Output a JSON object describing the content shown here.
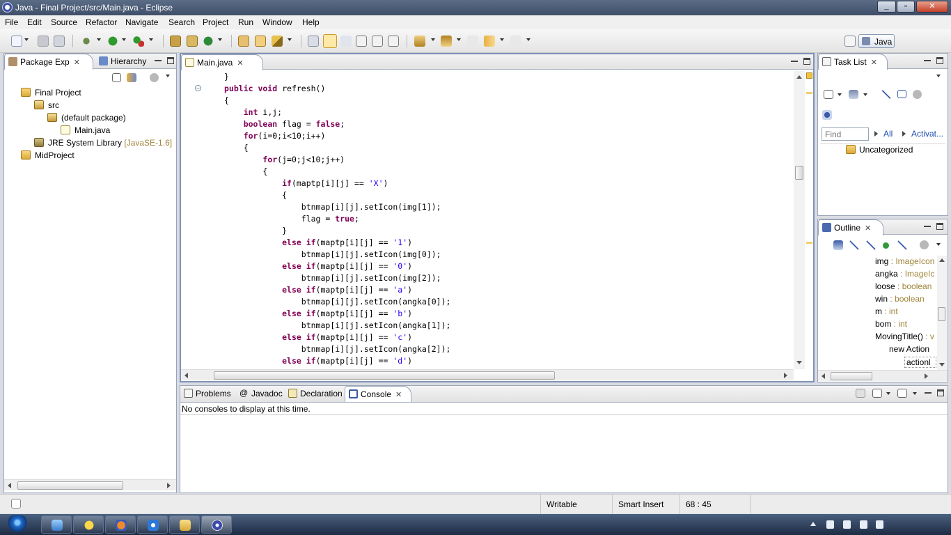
{
  "window": {
    "title": "Java - Final Project/src/Main.java - Eclipse"
  },
  "menu": [
    "File",
    "Edit",
    "Source",
    "Refactor",
    "Navigate",
    "Search",
    "Project",
    "Run",
    "Window",
    "Help"
  ],
  "perspective": {
    "label": "Java"
  },
  "package_explorer": {
    "tabs": [
      "Package Exp",
      "Hierarchy"
    ],
    "tree": [
      {
        "label": "Final Project",
        "decor": "",
        "icon": "project-icon"
      },
      {
        "label": "src",
        "decor": "",
        "icon": "source-folder-icon"
      },
      {
        "label": "(default package)",
        "decor": "",
        "icon": "package-icon"
      },
      {
        "label": "Main.java",
        "decor": "",
        "icon": "java-file-icon"
      },
      {
        "label": "JRE System Library",
        "decor": "[JavaSE-1.6]",
        "icon": "library-icon"
      },
      {
        "label": "MidProject",
        "decor": "",
        "icon": "project-icon"
      }
    ]
  },
  "editor": {
    "tab": "Main.java",
    "code": [
      {
        "indent": "",
        "tokens": [
          [
            "",
            "}"
          ]
        ]
      },
      {
        "indent": "",
        "tokens": [
          [
            "kw",
            "public void "
          ],
          [
            "",
            "refresh()"
          ]
        ]
      },
      {
        "indent": "",
        "tokens": [
          [
            "",
            "{"
          ]
        ]
      },
      {
        "indent": "    ",
        "tokens": [
          [
            "kw",
            "int "
          ],
          [
            "",
            "i,j;"
          ]
        ]
      },
      {
        "indent": "    ",
        "tokens": [
          [
            "kw",
            "boolean "
          ],
          [
            "",
            "flag = "
          ],
          [
            "kw",
            "false"
          ],
          [
            "",
            ";"
          ]
        ]
      },
      {
        "indent": "    ",
        "tokens": [
          [
            "kw",
            "for"
          ],
          [
            "",
            "(i=0;i<10;i++)"
          ]
        ]
      },
      {
        "indent": "    ",
        "tokens": [
          [
            "",
            "{"
          ]
        ]
      },
      {
        "indent": "        ",
        "tokens": [
          [
            "kw",
            "for"
          ],
          [
            "",
            "(j=0;j<10;j++)"
          ]
        ]
      },
      {
        "indent": "        ",
        "tokens": [
          [
            "",
            "{"
          ]
        ]
      },
      {
        "indent": "            ",
        "tokens": [
          [
            "kw",
            "if"
          ],
          [
            "",
            "(maptp[i][j] == "
          ],
          [
            "str",
            "'X'"
          ],
          [
            "",
            ")"
          ]
        ]
      },
      {
        "indent": "            ",
        "tokens": [
          [
            "",
            "{"
          ]
        ]
      },
      {
        "indent": "                ",
        "tokens": [
          [
            "",
            "btnmap[i][j].setIcon(img[1]);"
          ]
        ]
      },
      {
        "indent": "                ",
        "tokens": [
          [
            "",
            "flag = "
          ],
          [
            "kw",
            "true"
          ],
          [
            "",
            ";"
          ]
        ]
      },
      {
        "indent": "            ",
        "tokens": [
          [
            "",
            "}"
          ]
        ]
      },
      {
        "indent": "            ",
        "tokens": [
          [
            "kw",
            "else if"
          ],
          [
            "",
            "(maptp[i][j] == "
          ],
          [
            "str",
            "'1'"
          ],
          [
            "",
            ")"
          ]
        ]
      },
      {
        "indent": "                ",
        "tokens": [
          [
            "",
            "btnmap[i][j].setIcon(img[0]);"
          ]
        ]
      },
      {
        "indent": "            ",
        "tokens": [
          [
            "kw",
            "else if"
          ],
          [
            "",
            "(maptp[i][j] == "
          ],
          [
            "str",
            "'0'"
          ],
          [
            "",
            ")"
          ]
        ]
      },
      {
        "indent": "                ",
        "tokens": [
          [
            "",
            "btnmap[i][j].setIcon(img[2]);"
          ]
        ]
      },
      {
        "indent": "            ",
        "tokens": [
          [
            "kw",
            "else if"
          ],
          [
            "",
            "(maptp[i][j] == "
          ],
          [
            "str",
            "'a'"
          ],
          [
            "",
            ")"
          ]
        ]
      },
      {
        "indent": "                ",
        "tokens": [
          [
            "",
            "btnmap[i][j].setIcon(angka[0]);"
          ]
        ]
      },
      {
        "indent": "            ",
        "tokens": [
          [
            "kw",
            "else if"
          ],
          [
            "",
            "(maptp[i][j] == "
          ],
          [
            "str",
            "'b'"
          ],
          [
            "",
            ")"
          ]
        ]
      },
      {
        "indent": "                ",
        "tokens": [
          [
            "",
            "btnmap[i][j].setIcon(angka[1]);"
          ]
        ]
      },
      {
        "indent": "            ",
        "tokens": [
          [
            "kw",
            "else if"
          ],
          [
            "",
            "(maptp[i][j] == "
          ],
          [
            "str",
            "'c'"
          ],
          [
            "",
            ")"
          ]
        ]
      },
      {
        "indent": "                ",
        "tokens": [
          [
            "",
            "btnmap[i][j].setIcon(angka[2]);"
          ]
        ]
      },
      {
        "indent": "            ",
        "tokens": [
          [
            "kw",
            "else if"
          ],
          [
            "",
            "(maptp[i][j] == "
          ],
          [
            "str",
            "'d'"
          ],
          [
            "",
            ")"
          ]
        ]
      }
    ]
  },
  "task_list": {
    "tab": "Task List",
    "find_placeholder": "Find",
    "all_label": "All",
    "activate_label": "Activat...",
    "category": "Uncategorized"
  },
  "outline": {
    "tab": "Outline",
    "items": [
      {
        "name": "img",
        "type": " : ImageIcon"
      },
      {
        "name": "angka",
        "type": " : ImageIc"
      },
      {
        "name": "loose",
        "type": " : boolean"
      },
      {
        "name": "win",
        "type": " : boolean"
      },
      {
        "name": "m",
        "type": " : int"
      },
      {
        "name": "bom",
        "type": " : int"
      },
      {
        "name": "MovingTitle()",
        "type": " : v"
      },
      {
        "name": "new Action",
        "type": ""
      },
      {
        "name": "actionl",
        "type": ""
      }
    ]
  },
  "bottom_panel": {
    "tabs": [
      "Problems",
      "Javadoc",
      "Declaration",
      "Console"
    ],
    "message": "No consoles to display at this time."
  },
  "status": {
    "writable": "Writable",
    "insert_mode": "Smart Insert",
    "position": "68 : 45"
  },
  "colors": {
    "keyword": "#7f0055",
    "string": "#2a00ff",
    "active_border": "#7d92b6"
  }
}
